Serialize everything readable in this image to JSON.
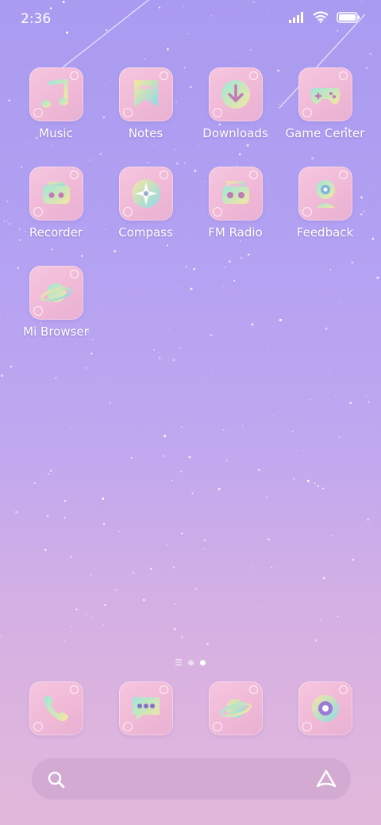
{
  "status_bar": {
    "time": "2:36",
    "signal_icon": "signal-bars-icon",
    "wifi_icon": "wifi-icon",
    "battery_icon": "battery-icon"
  },
  "apps": [
    {
      "label": "Music",
      "icon": "music-note-icon"
    },
    {
      "label": "Notes",
      "icon": "bookmark-note-icon"
    },
    {
      "label": "Downloads",
      "icon": "download-arrow-icon"
    },
    {
      "label": "Game Center",
      "icon": "gamepad-icon"
    },
    {
      "label": "Recorder",
      "icon": "tape-recorder-icon"
    },
    {
      "label": "Compass",
      "icon": "compass-icon"
    },
    {
      "label": "FM Radio",
      "icon": "radio-icon"
    },
    {
      "label": "Feedback",
      "icon": "webcam-icon"
    },
    {
      "label": "Mi Browser",
      "icon": "planet-icon"
    }
  ],
  "page_indicator": {
    "pages": 2,
    "current": 2
  },
  "dock": [
    {
      "icon": "phone-icon"
    },
    {
      "icon": "message-bubble-icon"
    },
    {
      "icon": "planet-icon"
    },
    {
      "icon": "camera-lens-icon"
    }
  ],
  "search_bar": {
    "search_icon": "search-icon",
    "assistant_icon": "assistant-icon"
  },
  "colors": {
    "icon_bg": "#f3c1dc",
    "glyph_gradient_start": "#9ee7d9",
    "glyph_gradient_end": "#f6e6a0",
    "label": "#ffffff"
  }
}
